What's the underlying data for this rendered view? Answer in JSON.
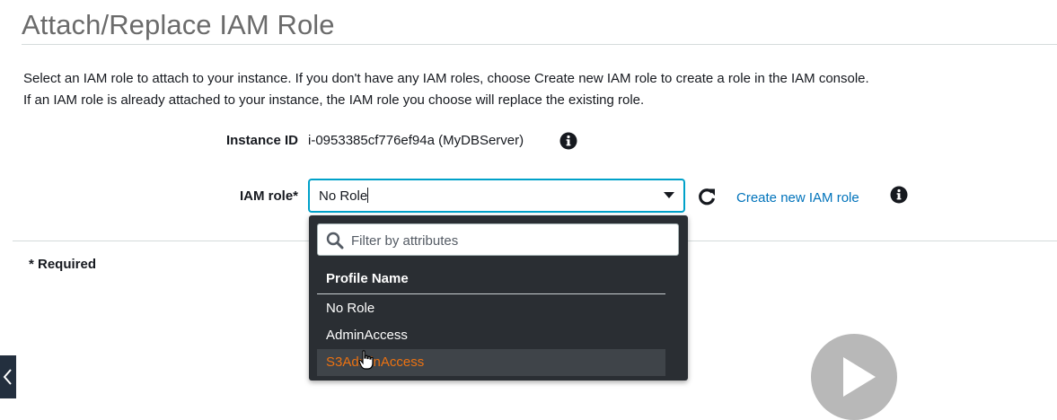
{
  "page": {
    "title": "Attach/Replace IAM Role",
    "description_line1": "Select an IAM role to attach to your instance. If you don't have any IAM roles, choose Create new IAM role to create a role in the IAM console.",
    "description_line2": "If an IAM role is already attached to your instance, the IAM role you choose will replace the existing role."
  },
  "form": {
    "instance_id_label": "Instance ID",
    "instance_id_value": "i-0953385cf776ef94a (MyDBServer)",
    "iam_role_label": "IAM role*",
    "iam_role_value": "No Role",
    "create_link": "Create new IAM role",
    "required_note": "* Required"
  },
  "dropdown": {
    "filter_placeholder": "Filter by attributes",
    "column_header": "Profile Name",
    "options": [
      {
        "label": "No Role"
      },
      {
        "label": "AdminAccess"
      },
      {
        "label": "S3AdminAccess"
      }
    ],
    "highlighted_option": "S3AdminAccess"
  },
  "icons": {
    "info": "info-icon",
    "refresh": "refresh-icon",
    "search": "search-icon",
    "dropdown_arrow": "caret-down-icon",
    "play": "play-icon",
    "back": "chevron-left-icon",
    "cursor": "hand-pointer-icon"
  },
  "colors": {
    "link": "#0073bb",
    "focus_border": "#00a1c9",
    "dropdown_bg": "#2a2e33",
    "highlight_text": "#ec7211"
  }
}
